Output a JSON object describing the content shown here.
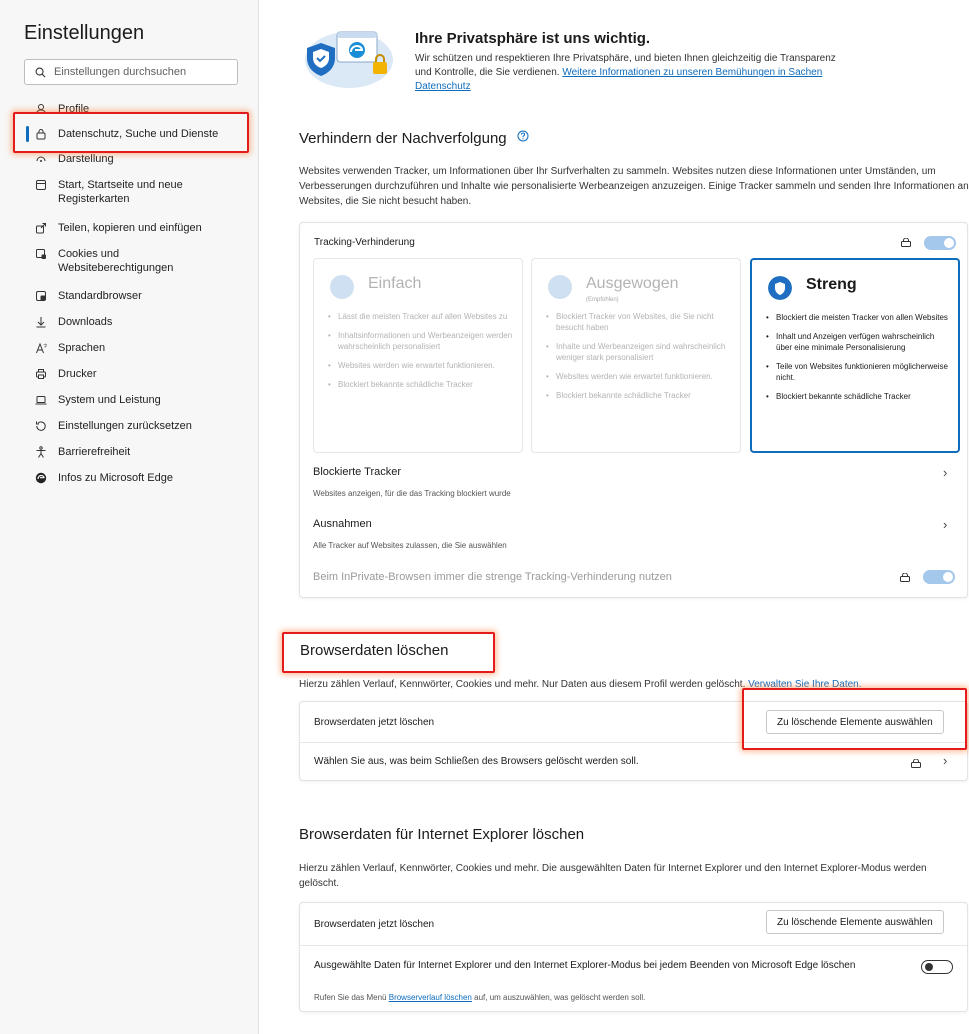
{
  "sidebar": {
    "title": "Einstellungen",
    "search_placeholder": "Einstellungen durchsuchen",
    "items": [
      {
        "label": "Profile",
        "icon": "profile-icon"
      },
      {
        "label": "Datenschutz, Suche und Dienste",
        "icon": "lock-icon",
        "active": true
      },
      {
        "label": "Darstellung",
        "icon": "appearance-icon"
      },
      {
        "label": "Start, Startseite und neue Registerkarten",
        "icon": "home-icon"
      },
      {
        "label": "Teilen, kopieren und einfügen",
        "icon": "share-icon"
      },
      {
        "label": "Cookies und Websiteberechtigungen",
        "icon": "cookie-icon"
      },
      {
        "label": "Standardbrowser",
        "icon": "browser-icon"
      },
      {
        "label": "Downloads",
        "icon": "download-icon"
      },
      {
        "label": "Sprachen",
        "icon": "language-icon"
      },
      {
        "label": "Drucker",
        "icon": "printer-icon"
      },
      {
        "label": "System und Leistung",
        "icon": "laptop-icon"
      },
      {
        "label": "Einstellungen zurücksetzen",
        "icon": "reset-icon"
      },
      {
        "label": "Barrierefreiheit",
        "icon": "accessibility-icon"
      },
      {
        "label": "Infos zu Microsoft Edge",
        "icon": "edge-icon"
      }
    ]
  },
  "hero": {
    "title": "Ihre Privatsphäre ist uns wichtig.",
    "text": "Wir schützen und respektieren Ihre Privatsphäre, und bieten Ihnen gleichzeitig die Transparenz und Kontrolle, die Sie verdienen.",
    "link": "Weitere Informationen zu unseren Bemühungen in Sachen Datenschutz"
  },
  "tracking": {
    "heading": "Verhindern der Nachverfolgung",
    "description": "Websites verwenden Tracker, um Informationen über Ihr Surfverhalten zu sammeln. Websites nutzen diese Informationen unter Umständen, um Verbesserungen durchzuführen und Inhalte wie personalisierte Werbeanzeigen anzuzeigen. Einige Tracker sammeln und senden Ihre Informationen an Websites, die Sie nicht besucht haben.",
    "card_title": "Tracking-Verhinderung",
    "toggle_on": true,
    "levels": [
      {
        "name": "Einfach",
        "subtitle": "",
        "bullets": [
          "Lässt die meisten Tracker auf allen Websites zu",
          "Inhaltsinformationen und Werbeanzeigen werden wahrscheinlich personalisiert",
          "Websites werden wie erwartet funktionieren.",
          "Blockiert bekannte schädliche Tracker"
        ]
      },
      {
        "name": "Ausgewogen",
        "subtitle": "(Empfohlen)",
        "bullets": [
          "Blockiert Tracker von Websites, die Sie nicht besucht haben",
          "Inhalte und Werbeanzeigen sind wahrscheinlich weniger stark personalisiert",
          "Websites werden wie erwartet funktionieren.",
          "Blockiert bekannte schädliche Tracker"
        ]
      },
      {
        "name": "Streng",
        "subtitle": "",
        "bullets": [
          "Blockiert die meisten Tracker von allen Websites",
          "Inhalt und Anzeigen verfügen wahrscheinlich über eine minimale Personalisierung",
          "Teile von Websites funktionieren möglicherweise nicht.",
          "Blockiert bekannte schädliche Tracker"
        ]
      }
    ],
    "blocked_title": "Blockierte Tracker",
    "blocked_sub": "Websites anzeigen, für die das Tracking blockiert wurde",
    "exceptions_title": "Ausnahmen",
    "exceptions_sub": "Alle Tracker auf Websites zulassen, die Sie auswählen",
    "inprivate_label": "Beim InPrivate-Browsen immer die strenge Tracking-Verhinderung nutzen"
  },
  "clear": {
    "heading": "Browserdaten löschen",
    "description": "Hierzu zählen Verlauf, Kennwörter, Cookies und mehr. Nur Daten aus diesem Profil werden gelöscht.",
    "link": "Verwalten Sie Ihre Daten.",
    "row1": "Browserdaten jetzt löschen",
    "button": "Zu löschende Elemente auswählen",
    "row2": "Wählen Sie aus, was beim Schließen des Browsers gelöscht werden soll."
  },
  "ie": {
    "heading": "Browserdaten für Internet Explorer löschen",
    "description": "Hierzu zählen Verlauf, Kennwörter, Cookies und mehr. Die ausgewählten Daten für Internet Explorer und den Internet Explorer-Modus werden gelöscht.",
    "row1": "Browserdaten jetzt löschen",
    "button": "Zu löschende Elemente auswählen",
    "row2": "Ausgewählte Daten für Internet Explorer und den Internet Explorer-Modus bei jedem Beenden von Microsoft Edge löschen",
    "row2_sub_pre": "Rufen Sie das Menü",
    "row2_link": "Browserverlauf löschen",
    "row2_sub_post": "auf, um auszuwählen, was gelöscht werden soll.",
    "toggle_on": false
  },
  "colors": {
    "accent": "#0f6cbd",
    "highlight": "#e31b1b"
  }
}
